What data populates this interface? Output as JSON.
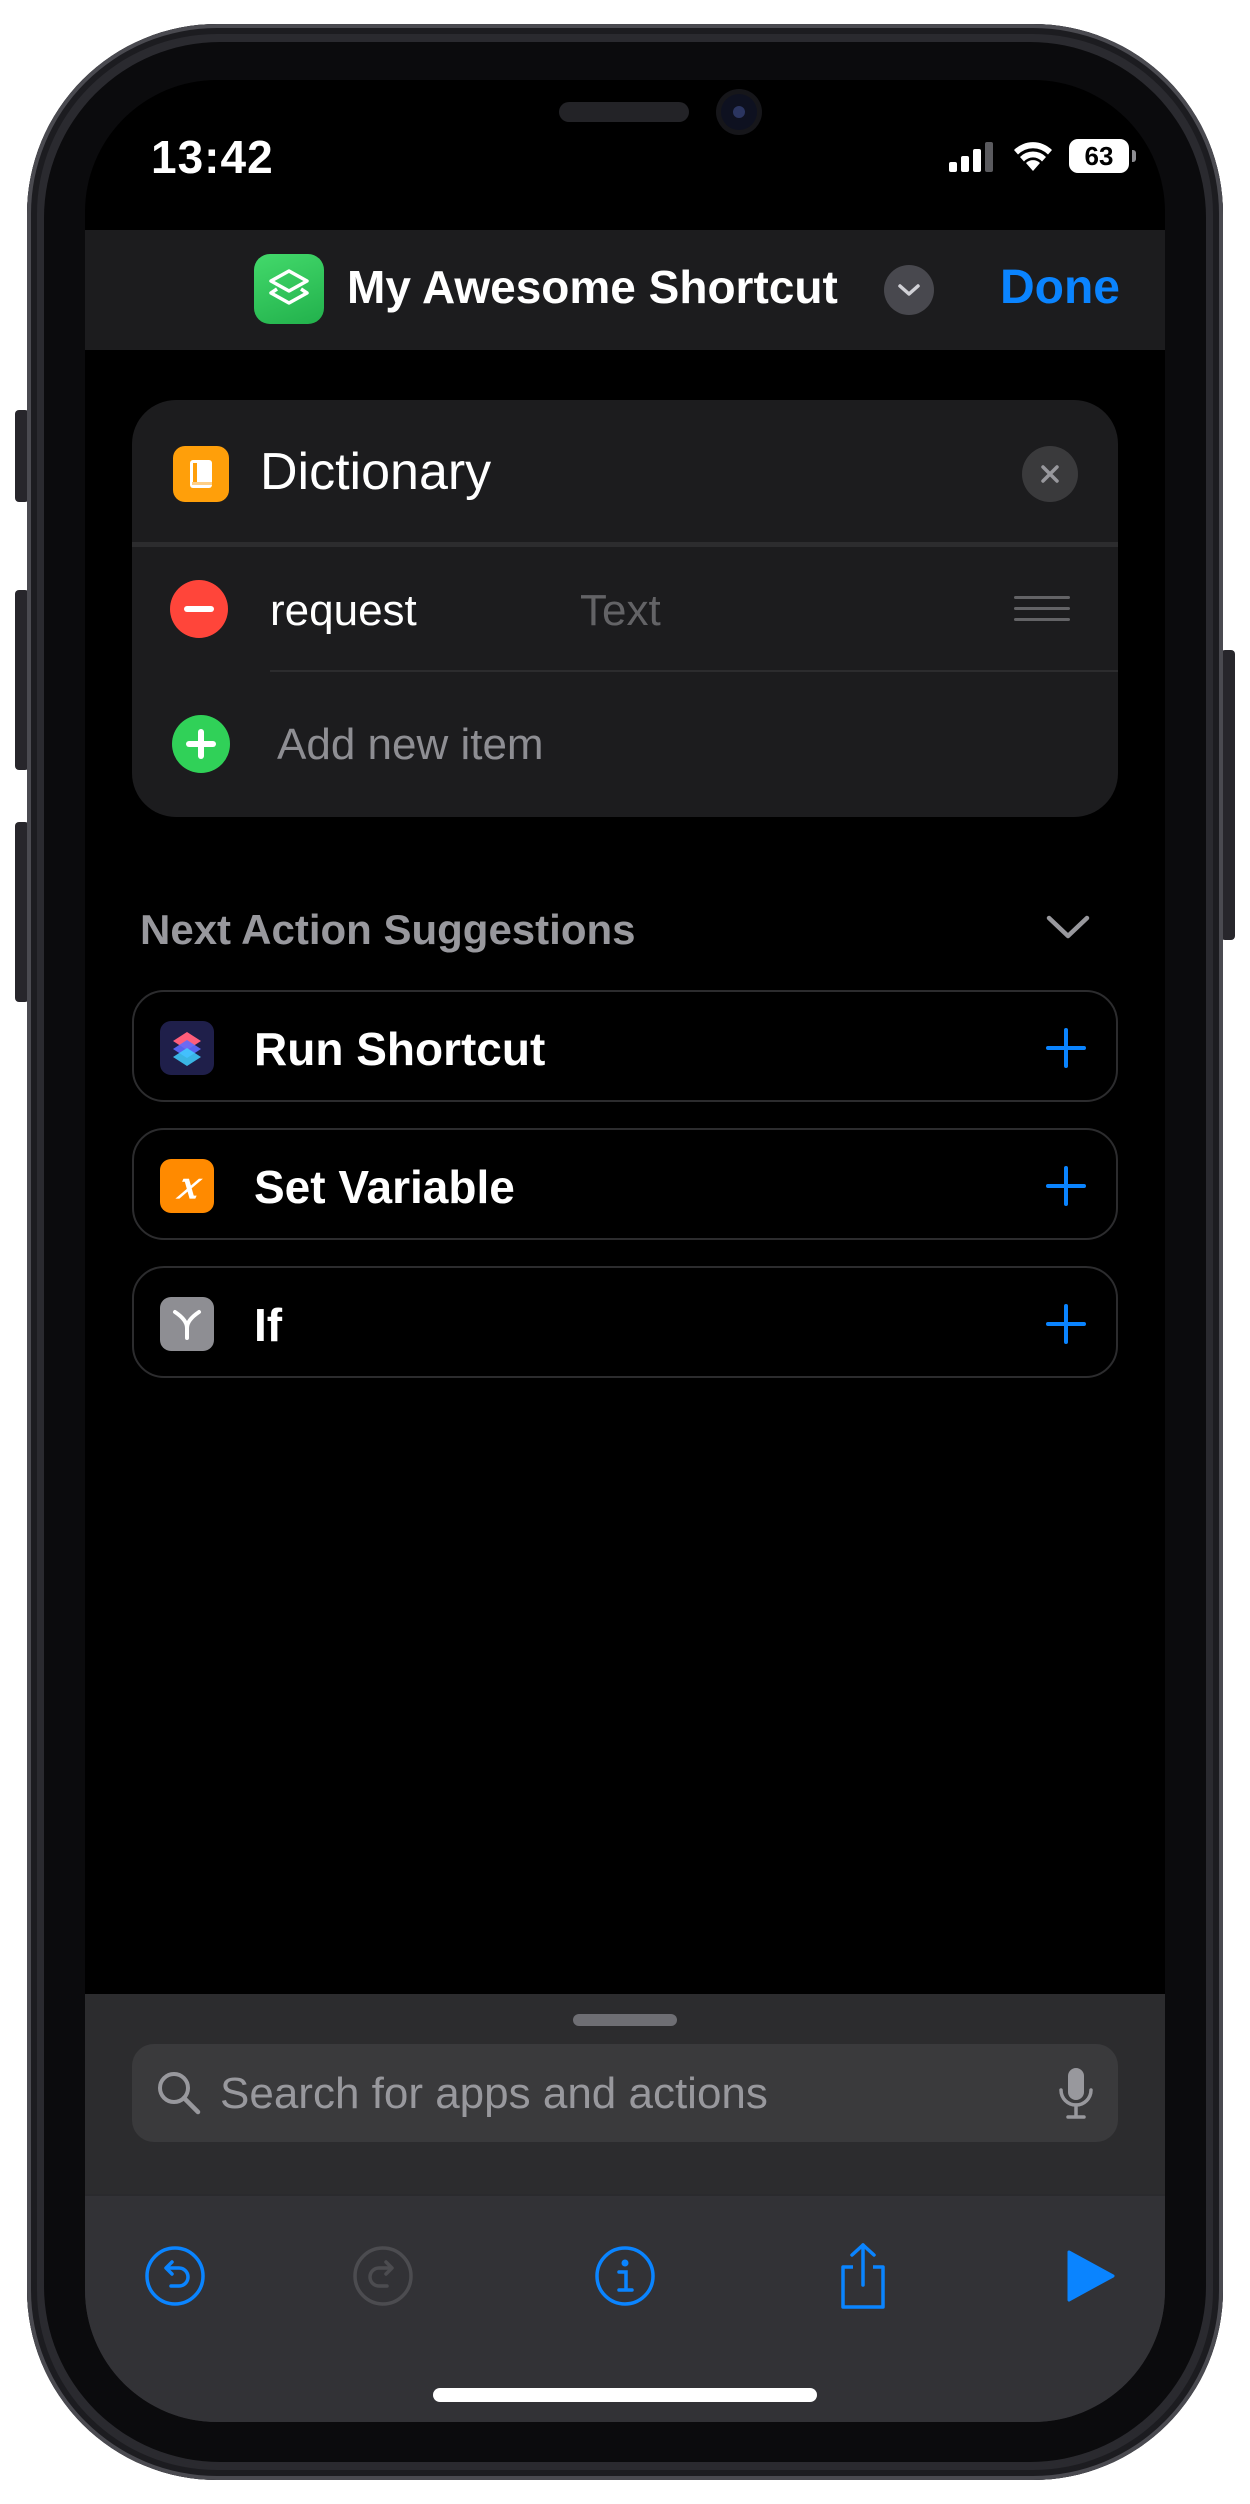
{
  "status_bar": {
    "time": "13:42",
    "battery": "63"
  },
  "nav": {
    "title": "My Awesome Shortcut",
    "done_label": "Done"
  },
  "dictionary_card": {
    "title": "Dictionary",
    "items": [
      {
        "key": "request",
        "type": "Text"
      }
    ],
    "add_label": "Add new item"
  },
  "suggestions": {
    "header": "Next Action Suggestions",
    "items": [
      {
        "label": "Run Shortcut",
        "icon": "shortcuts-icon",
        "color": "#1f1f4a"
      },
      {
        "label": "Set Variable",
        "icon": "variable-x-icon",
        "color": "#ff8a00"
      },
      {
        "label": "If",
        "icon": "branch-y-icon",
        "color": "#8e8e93"
      }
    ]
  },
  "bottom": {
    "search_placeholder": "Search for apps and actions",
    "toolbar": [
      "undo-icon",
      "redo-icon",
      "info-icon",
      "share-icon",
      "play-icon"
    ]
  },
  "colors": {
    "accent": "#0a84ff",
    "remove": "#ff453a",
    "add": "#30d158",
    "dictionary": "#ff9f0a"
  }
}
